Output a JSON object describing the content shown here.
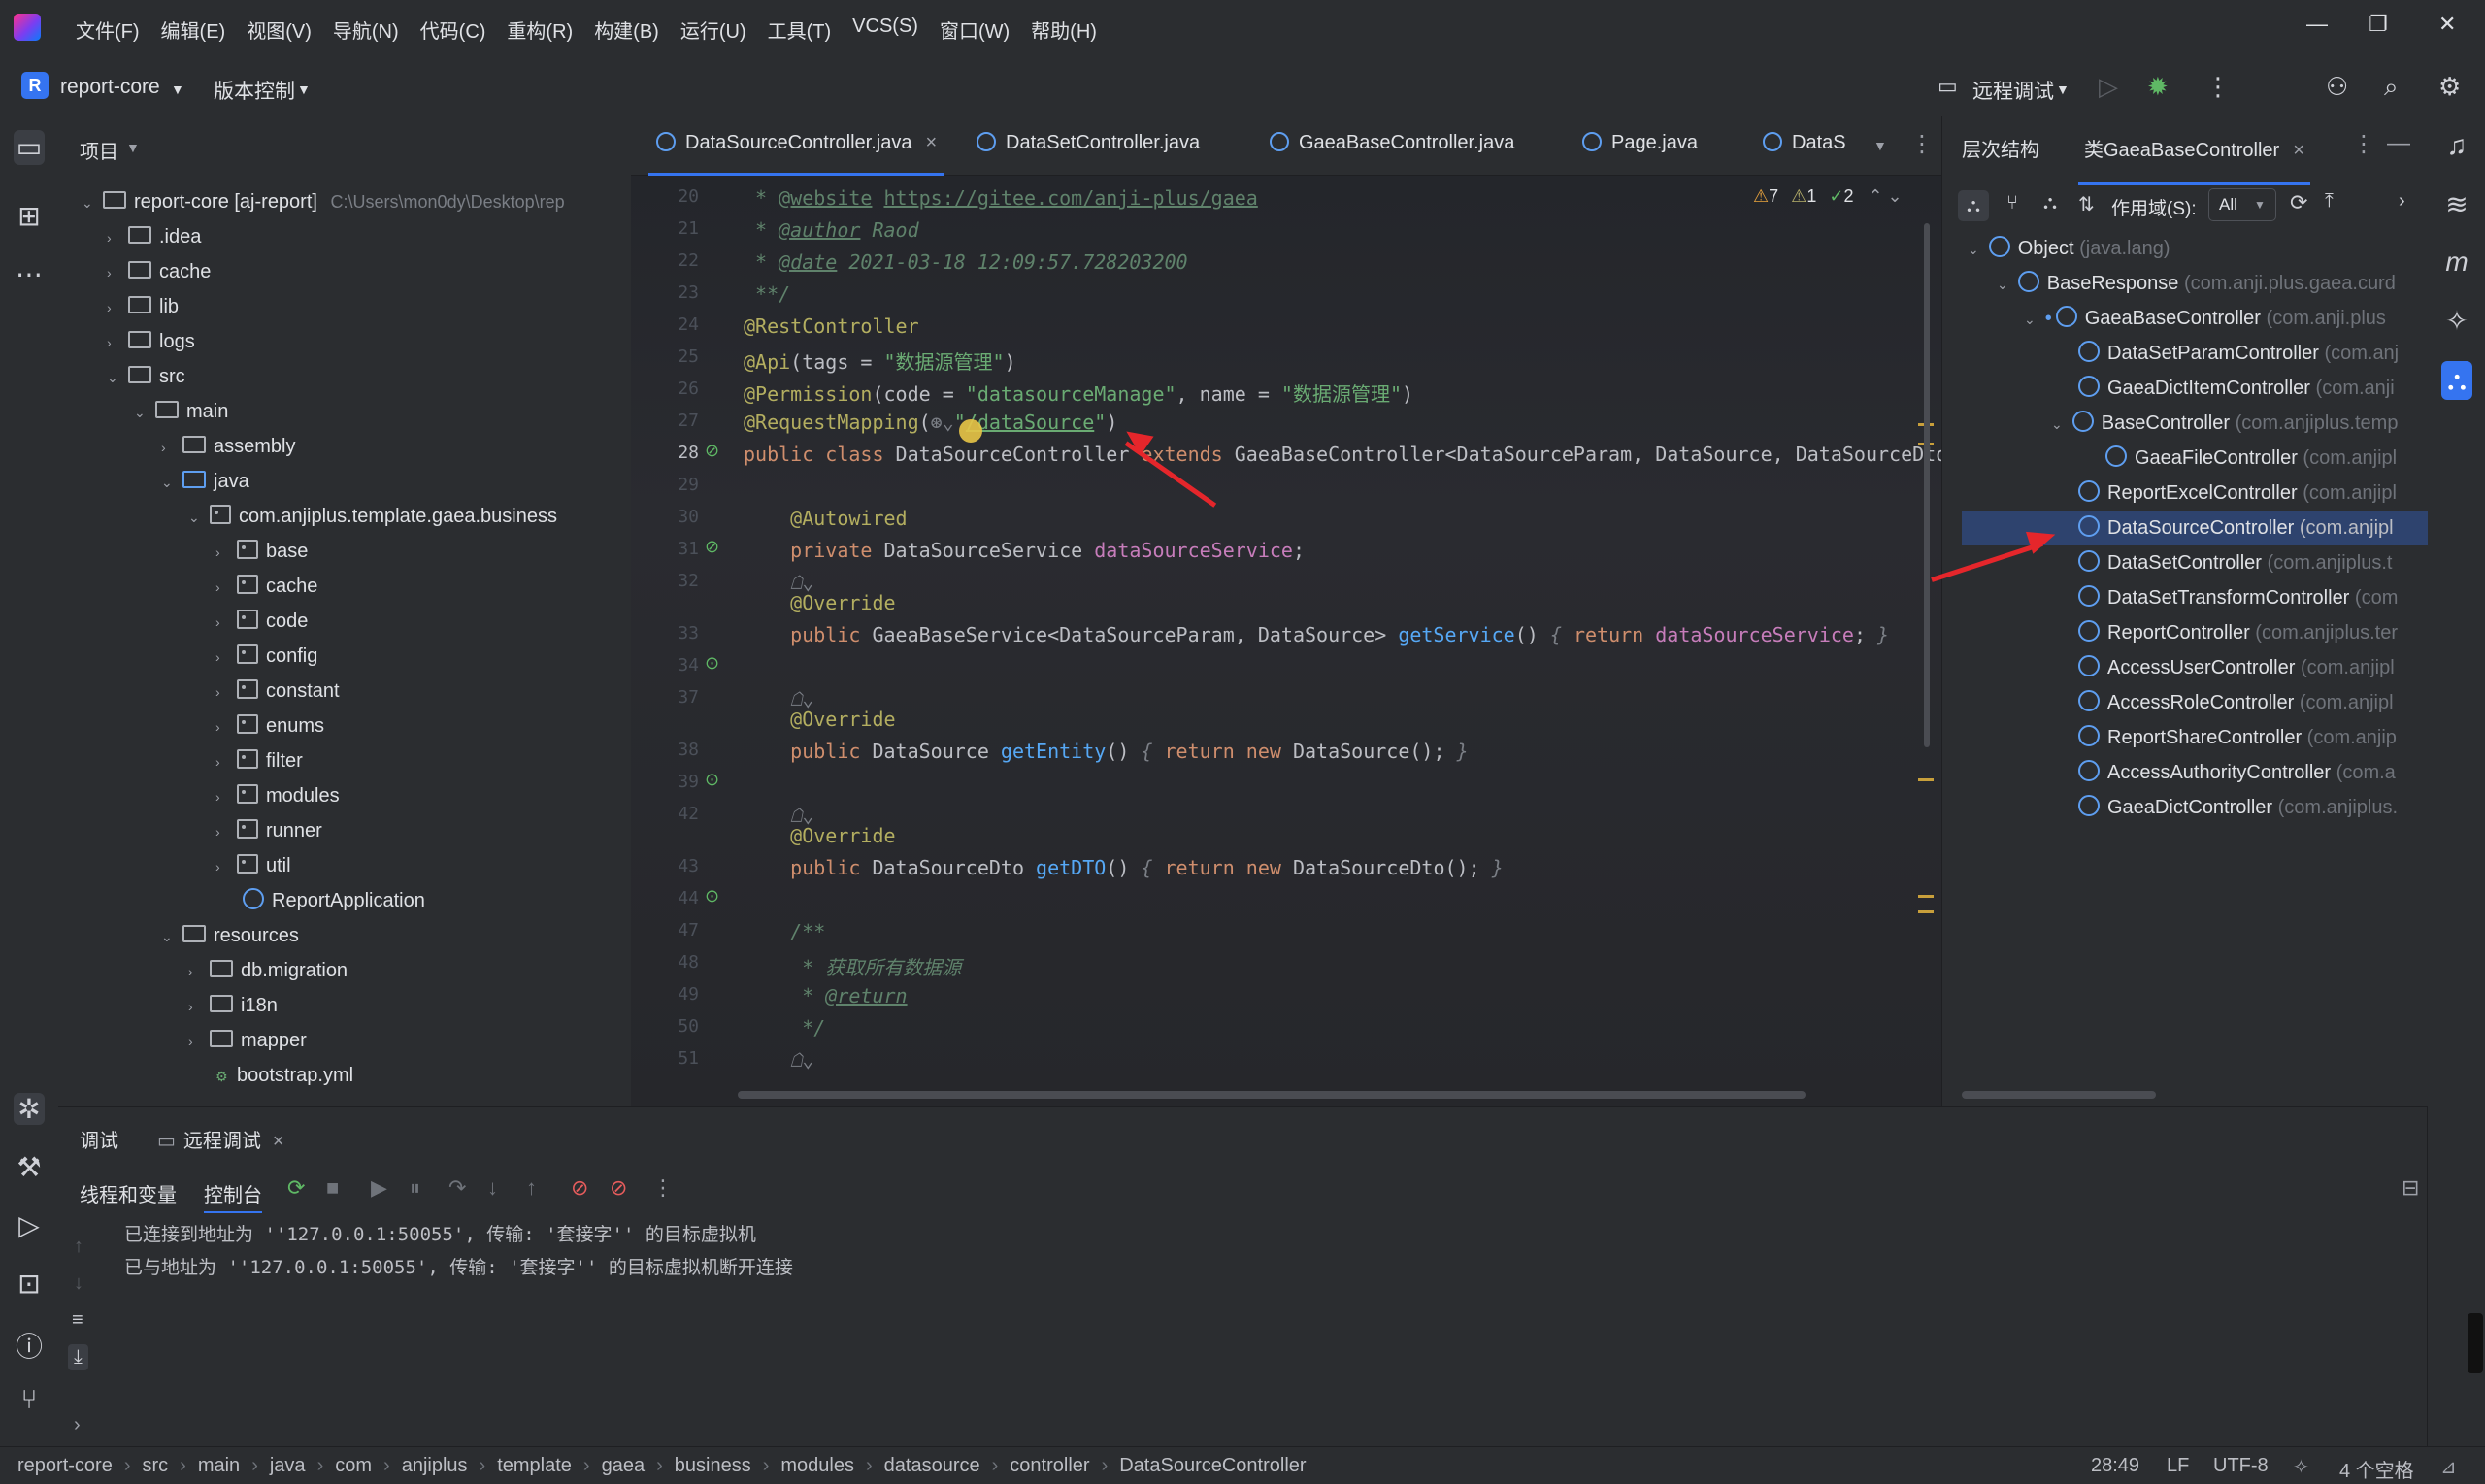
{
  "menubar": {
    "items": [
      "文件(F)",
      "编辑(E)",
      "视图(V)",
      "导航(N)",
      "代码(C)",
      "重构(R)",
      "构建(B)",
      "运行(U)",
      "工具(T)",
      "VCS(S)",
      "窗口(W)",
      "帮助(H)"
    ]
  },
  "toolbar": {
    "project_letter": "R",
    "project_name": "report-core",
    "vcs_label": "版本控制",
    "run_config": "远程调试"
  },
  "project_panel": {
    "title": "项目",
    "root_name": "report-core [aj-report]",
    "root_path": "C:\\Users\\mon0dy\\Desktop\\rep",
    "rows": [
      {
        "label": ".idea"
      },
      {
        "label": "cache"
      },
      {
        "label": "lib"
      },
      {
        "label": "logs"
      },
      {
        "label": "src"
      },
      {
        "label": "main"
      },
      {
        "label": "assembly"
      },
      {
        "label": "java"
      },
      {
        "label": "com.anjiplus.template.gaea.business"
      },
      {
        "label": "base"
      },
      {
        "label": "cache"
      },
      {
        "label": "code"
      },
      {
        "label": "config"
      },
      {
        "label": "constant"
      },
      {
        "label": "enums"
      },
      {
        "label": "filter"
      },
      {
        "label": "modules"
      },
      {
        "label": "runner"
      },
      {
        "label": "util"
      },
      {
        "label": "ReportApplication"
      },
      {
        "label": "resources"
      },
      {
        "label": "db.migration"
      },
      {
        "label": "i18n"
      },
      {
        "label": "mapper"
      },
      {
        "label": "bootstrap.yml"
      }
    ]
  },
  "editor": {
    "tabs": [
      "DataSourceController.java",
      "DataSetController.java",
      "GaeaBaseController.java",
      "Page.java",
      "DataS"
    ],
    "inspections": {
      "warnings": "7",
      "weak_warnings": "1",
      "ok": "2"
    },
    "line_numbers": [
      "20",
      "21",
      "22",
      "23",
      "24",
      "25",
      "26",
      "27",
      "28",
      "29",
      "30",
      "31",
      "32",
      "33",
      "34",
      "37",
      "38",
      "39",
      "42",
      "43",
      "44",
      "47",
      "48",
      "49",
      "50",
      "51"
    ]
  },
  "hierarchy": {
    "title": "层次结构",
    "tab_label": "类GaeaBaseController",
    "scope_label": "作用域(S):",
    "scope_value": "All",
    "rows": [
      {
        "name": "Object",
        "pkg": "(java.lang)"
      },
      {
        "name": "BaseResponse",
        "pkg": "(com.anji.plus.gaea.curd"
      },
      {
        "name": "GaeaBaseController",
        "pkg": "(com.anji.plus"
      },
      {
        "name": "DataSetParamController",
        "pkg": "(com.anj"
      },
      {
        "name": "GaeaDictItemController",
        "pkg": "(com.anji"
      },
      {
        "name": "BaseController",
        "pkg": "(com.anjiplus.temp"
      },
      {
        "name": "GaeaFileController",
        "pkg": "(com.anjipl"
      },
      {
        "name": "ReportExcelController",
        "pkg": "(com.anjipl"
      },
      {
        "name": "DataSourceController",
        "pkg": "(com.anjipl"
      },
      {
        "name": "DataSetController",
        "pkg": "(com.anjiplus.t"
      },
      {
        "name": "DataSetTransformController",
        "pkg": "(com"
      },
      {
        "name": "ReportController",
        "pkg": "(com.anjiplus.ter"
      },
      {
        "name": "AccessUserController",
        "pkg": "(com.anjipl"
      },
      {
        "name": "AccessRoleController",
        "pkg": "(com.anjipl"
      },
      {
        "name": "ReportShareController",
        "pkg": "(com.anjip"
      },
      {
        "name": "AccessAuthorityController",
        "pkg": "(com.a"
      },
      {
        "name": "GaeaDictController",
        "pkg": "(com.anjiplus."
      }
    ]
  },
  "debug": {
    "tab_debug": "调试",
    "tab_remote": "远程调试",
    "threads_label": "线程和变量",
    "console_label": "控制台",
    "console_lines": [
      "已连接到地址为 ''127.0.0.1:50055', 传输: '套接字'' 的目标虚拟机",
      "已与地址为 ''127.0.0.1:50055', 传输: '套接字'' 的目标虚拟机断开连接"
    ]
  },
  "status": {
    "crumbs": [
      "report-core",
      "src",
      "main",
      "java",
      "com",
      "anjiplus",
      "template",
      "gaea",
      "business",
      "modules",
      "datasource",
      "controller",
      "DataSourceController"
    ],
    "position": "28:49",
    "line_sep": "LF",
    "encoding": "UTF-8",
    "indent": "4 个空格"
  },
  "colors": {
    "accent": "#3574f0",
    "annotation_arrow": "#e5262b"
  }
}
